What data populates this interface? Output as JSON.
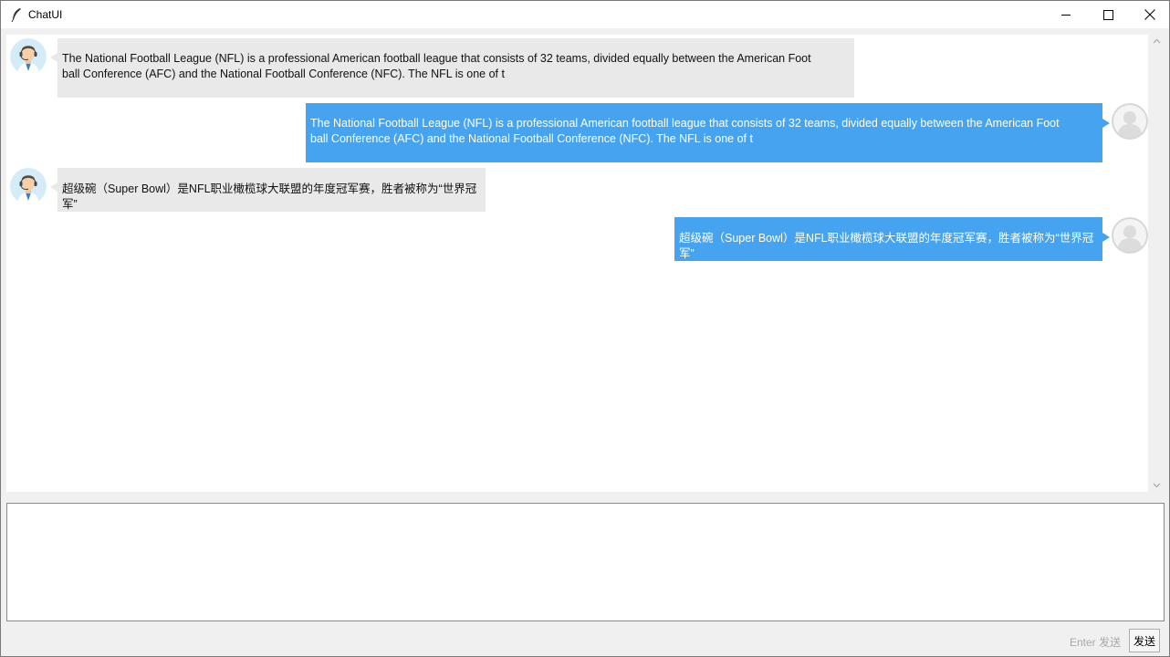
{
  "window": {
    "title": "ChatUI"
  },
  "icons": {
    "app": "feather-icon",
    "minimize": "minimize-icon",
    "maximize": "maximize-icon",
    "close": "close-icon",
    "bot_avatar": "bot-avatar",
    "user_avatar": "user-avatar"
  },
  "colors": {
    "bot_bubble": "#e9e9e9",
    "user_bubble": "#46a3ef"
  },
  "messages": [
    {
      "sender": "bot",
      "lines": [
        "The National Football League (NFL) is a professional American football league that consists of 32 teams, divided equally between the American Foot",
        "ball Conference (AFC) and the National Football Conference (NFC). The NFL is one of t"
      ]
    },
    {
      "sender": "user",
      "lines": [
        "The National Football League (NFL) is a professional American football league that consists of 32 teams, divided equally between the American Foot",
        "ball Conference (AFC) and the National Football Conference (NFC). The NFL is one of t"
      ]
    },
    {
      "sender": "bot",
      "lines": [
        "超级碗（Super Bowl）是NFL职业橄榄球大联盟的年度冠军赛，胜者被称为“世界冠军”"
      ]
    },
    {
      "sender": "user",
      "lines": [
        "超级碗（Super Bowl）是NFL职业橄榄球大联盟的年度冠军赛，胜者被称为“世界冠军”"
      ]
    }
  ],
  "input": {
    "value": "",
    "hint": "Enter 发送",
    "send_label": "发送"
  }
}
